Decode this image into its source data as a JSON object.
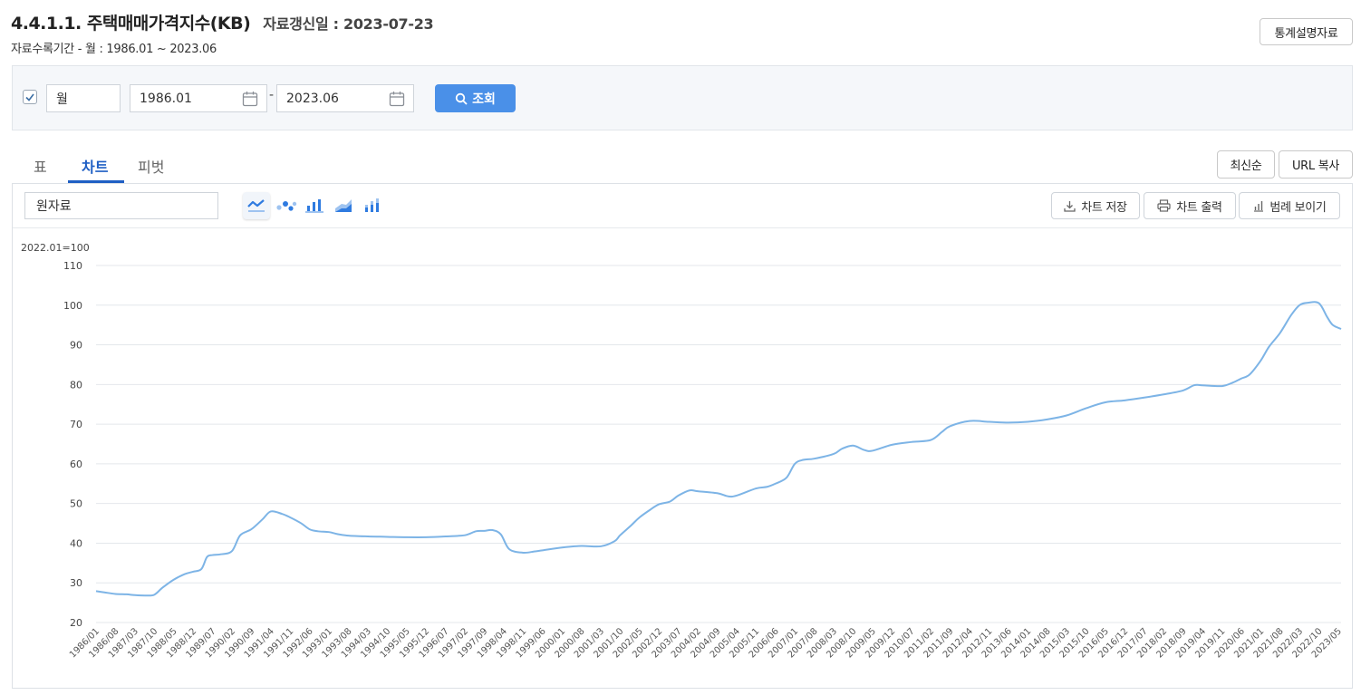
{
  "header": {
    "title": "4.4.1.1. 주택매매가격지수(KB)",
    "updated": "자료갱신일 : 2023-07-23",
    "period": "자료수록기간 - 월 : 1986.01 ~ 2023.06",
    "guide_button": "통계설명자료"
  },
  "search": {
    "checked": true,
    "frequency": "월",
    "start": "1986.01",
    "separator": "-",
    "end": "2023.06",
    "search_button": "조회"
  },
  "tabs": [
    "표",
    "차트",
    "피벗"
  ],
  "active_tab": "차트",
  "view_buttons": {
    "latest": "최신순",
    "copy_url": "URL 복사"
  },
  "chart_toolbar": {
    "series_select": "원자료",
    "chart_types": [
      "line-chart-icon",
      "scatter-chart-icon",
      "bar-chart-icon",
      "area-chart-icon",
      "stacked-bar-chart-icon"
    ],
    "save": "차트 저장",
    "print": "차트 출력",
    "legend": "범례 보이기"
  },
  "colors": {
    "line": "#7db4e6",
    "accent": "#4a90e8",
    "tab_active": "#1f5fc4"
  },
  "chart_data": {
    "type": "line",
    "unit_label": "2022.01=100",
    "ylim": [
      20,
      110
    ],
    "yticks": [
      20,
      30,
      40,
      50,
      60,
      70,
      80,
      90,
      100,
      110
    ],
    "grid": true,
    "xticks": [
      "1986/01",
      "1986/08",
      "1987/03",
      "1987/10",
      "1988/05",
      "1988/12",
      "1989/07",
      "1990/02",
      "1990/09",
      "1991/04",
      "1991/11",
      "1992/06",
      "1993/01",
      "1993/08",
      "1994/03",
      "1994/10",
      "1995/05",
      "1995/12",
      "1996/07",
      "1997/02",
      "1997/09",
      "1998/04",
      "1998/11",
      "1999/06",
      "2000/01",
      "2000/08",
      "2001/03",
      "2001/10",
      "2002/05",
      "2002/12",
      "2003/07",
      "2004/02",
      "2004/09",
      "2005/04",
      "2005/11",
      "2006/06",
      "2007/01",
      "2007/08",
      "2008/03",
      "2008/10",
      "2009/05",
      "2009/12",
      "2010/07",
      "2011/02",
      "2011/09",
      "2012/04",
      "2012/11",
      "2013/06",
      "2014/01",
      "2014/08",
      "2015/03",
      "2015/10",
      "2016/05",
      "2016/12",
      "2017/07",
      "2018/02",
      "2018/09",
      "2019/04",
      "2019/11",
      "2020/06",
      "2021/01",
      "2021/08",
      "2022/03",
      "2022/10",
      "2023/05"
    ],
    "x_start": "1986/01",
    "x_end": "2023/06",
    "points": [
      [
        "1986/01",
        27.9
      ],
      [
        "1986/04",
        27.6
      ],
      [
        "1986/08",
        27.2
      ],
      [
        "1986/12",
        27.1
      ],
      [
        "1987/03",
        26.9
      ],
      [
        "1987/07",
        26.8
      ],
      [
        "1987/10",
        27.0
      ],
      [
        "1988/01",
        28.8
      ],
      [
        "1988/05",
        30.8
      ],
      [
        "1988/09",
        32.2
      ],
      [
        "1988/12",
        32.8
      ],
      [
        "1989/03",
        33.5
      ],
      [
        "1989/05",
        36.5
      ],
      [
        "1989/07",
        37.0
      ],
      [
        "1989/10",
        37.2
      ],
      [
        "1990/02",
        38.0
      ],
      [
        "1990/05",
        42.0
      ],
      [
        "1990/09",
        43.5
      ],
      [
        "1991/01",
        46.0
      ],
      [
        "1991/04",
        48.0
      ],
      [
        "1991/08",
        47.4
      ],
      [
        "1991/11",
        46.5
      ],
      [
        "1992/03",
        45.0
      ],
      [
        "1992/06",
        43.5
      ],
      [
        "1992/09",
        43.0
      ],
      [
        "1993/01",
        42.8
      ],
      [
        "1993/04",
        42.3
      ],
      [
        "1993/08",
        41.9
      ],
      [
        "1994/03",
        41.7
      ],
      [
        "1994/10",
        41.6
      ],
      [
        "1995/05",
        41.5
      ],
      [
        "1995/12",
        41.5
      ],
      [
        "1996/07",
        41.7
      ],
      [
        "1997/02",
        42.0
      ],
      [
        "1997/06",
        43.0
      ],
      [
        "1997/09",
        43.1
      ],
      [
        "1997/12",
        43.3
      ],
      [
        "1998/03",
        42.2
      ],
      [
        "1998/06",
        38.5
      ],
      [
        "1998/11",
        37.6
      ],
      [
        "1999/03",
        37.9
      ],
      [
        "1999/06",
        38.2
      ],
      [
        "2000/01",
        38.9
      ],
      [
        "2000/08",
        39.3
      ],
      [
        "2001/03",
        39.2
      ],
      [
        "2001/08",
        40.5
      ],
      [
        "2001/10",
        42.0
      ],
      [
        "2002/02",
        44.5
      ],
      [
        "2002/05",
        46.5
      ],
      [
        "2002/09",
        48.5
      ],
      [
        "2002/12",
        49.8
      ],
      [
        "2003/04",
        50.5
      ],
      [
        "2003/07",
        52.0
      ],
      [
        "2003/11",
        53.3
      ],
      [
        "2004/02",
        53.1
      ],
      [
        "2004/09",
        52.6
      ],
      [
        "2005/01",
        51.8
      ],
      [
        "2005/04",
        52.0
      ],
      [
        "2005/11",
        53.8
      ],
      [
        "2006/03",
        54.2
      ],
      [
        "2006/06",
        55.0
      ],
      [
        "2006/10",
        56.5
      ],
      [
        "2007/01",
        60.0
      ],
      [
        "2007/04",
        61.0
      ],
      [
        "2007/08",
        61.3
      ],
      [
        "2008/03",
        62.5
      ],
      [
        "2008/06",
        63.8
      ],
      [
        "2008/10",
        64.6
      ],
      [
        "2009/02",
        63.5
      ],
      [
        "2009/05",
        63.3
      ],
      [
        "2009/12",
        64.8
      ],
      [
        "2010/07",
        65.5
      ],
      [
        "2011/02",
        66.0
      ],
      [
        "2011/06",
        68.0
      ],
      [
        "2011/09",
        69.5
      ],
      [
        "2012/04",
        70.8
      ],
      [
        "2012/11",
        70.6
      ],
      [
        "2013/06",
        70.4
      ],
      [
        "2014/01",
        70.6
      ],
      [
        "2014/08",
        71.2
      ],
      [
        "2015/03",
        72.2
      ],
      [
        "2015/10",
        74.0
      ],
      [
        "2016/05",
        75.5
      ],
      [
        "2016/12",
        76.0
      ],
      [
        "2017/07",
        76.7
      ],
      [
        "2018/02",
        77.5
      ],
      [
        "2018/09",
        78.5
      ],
      [
        "2019/01",
        79.8
      ],
      [
        "2019/04",
        79.8
      ],
      [
        "2019/11",
        79.6
      ],
      [
        "2020/03",
        80.5
      ],
      [
        "2020/06",
        81.5
      ],
      [
        "2020/09",
        82.5
      ],
      [
        "2021/01",
        86.0
      ],
      [
        "2021/04",
        89.5
      ],
      [
        "2021/08",
        93.0
      ],
      [
        "2021/12",
        97.5
      ],
      [
        "2022/03",
        100.0
      ],
      [
        "2022/06",
        100.6
      ],
      [
        "2022/10",
        100.5
      ],
      [
        "2023/01",
        97.0
      ],
      [
        "2023/03",
        95.0
      ],
      [
        "2023/06",
        94.0
      ]
    ]
  }
}
